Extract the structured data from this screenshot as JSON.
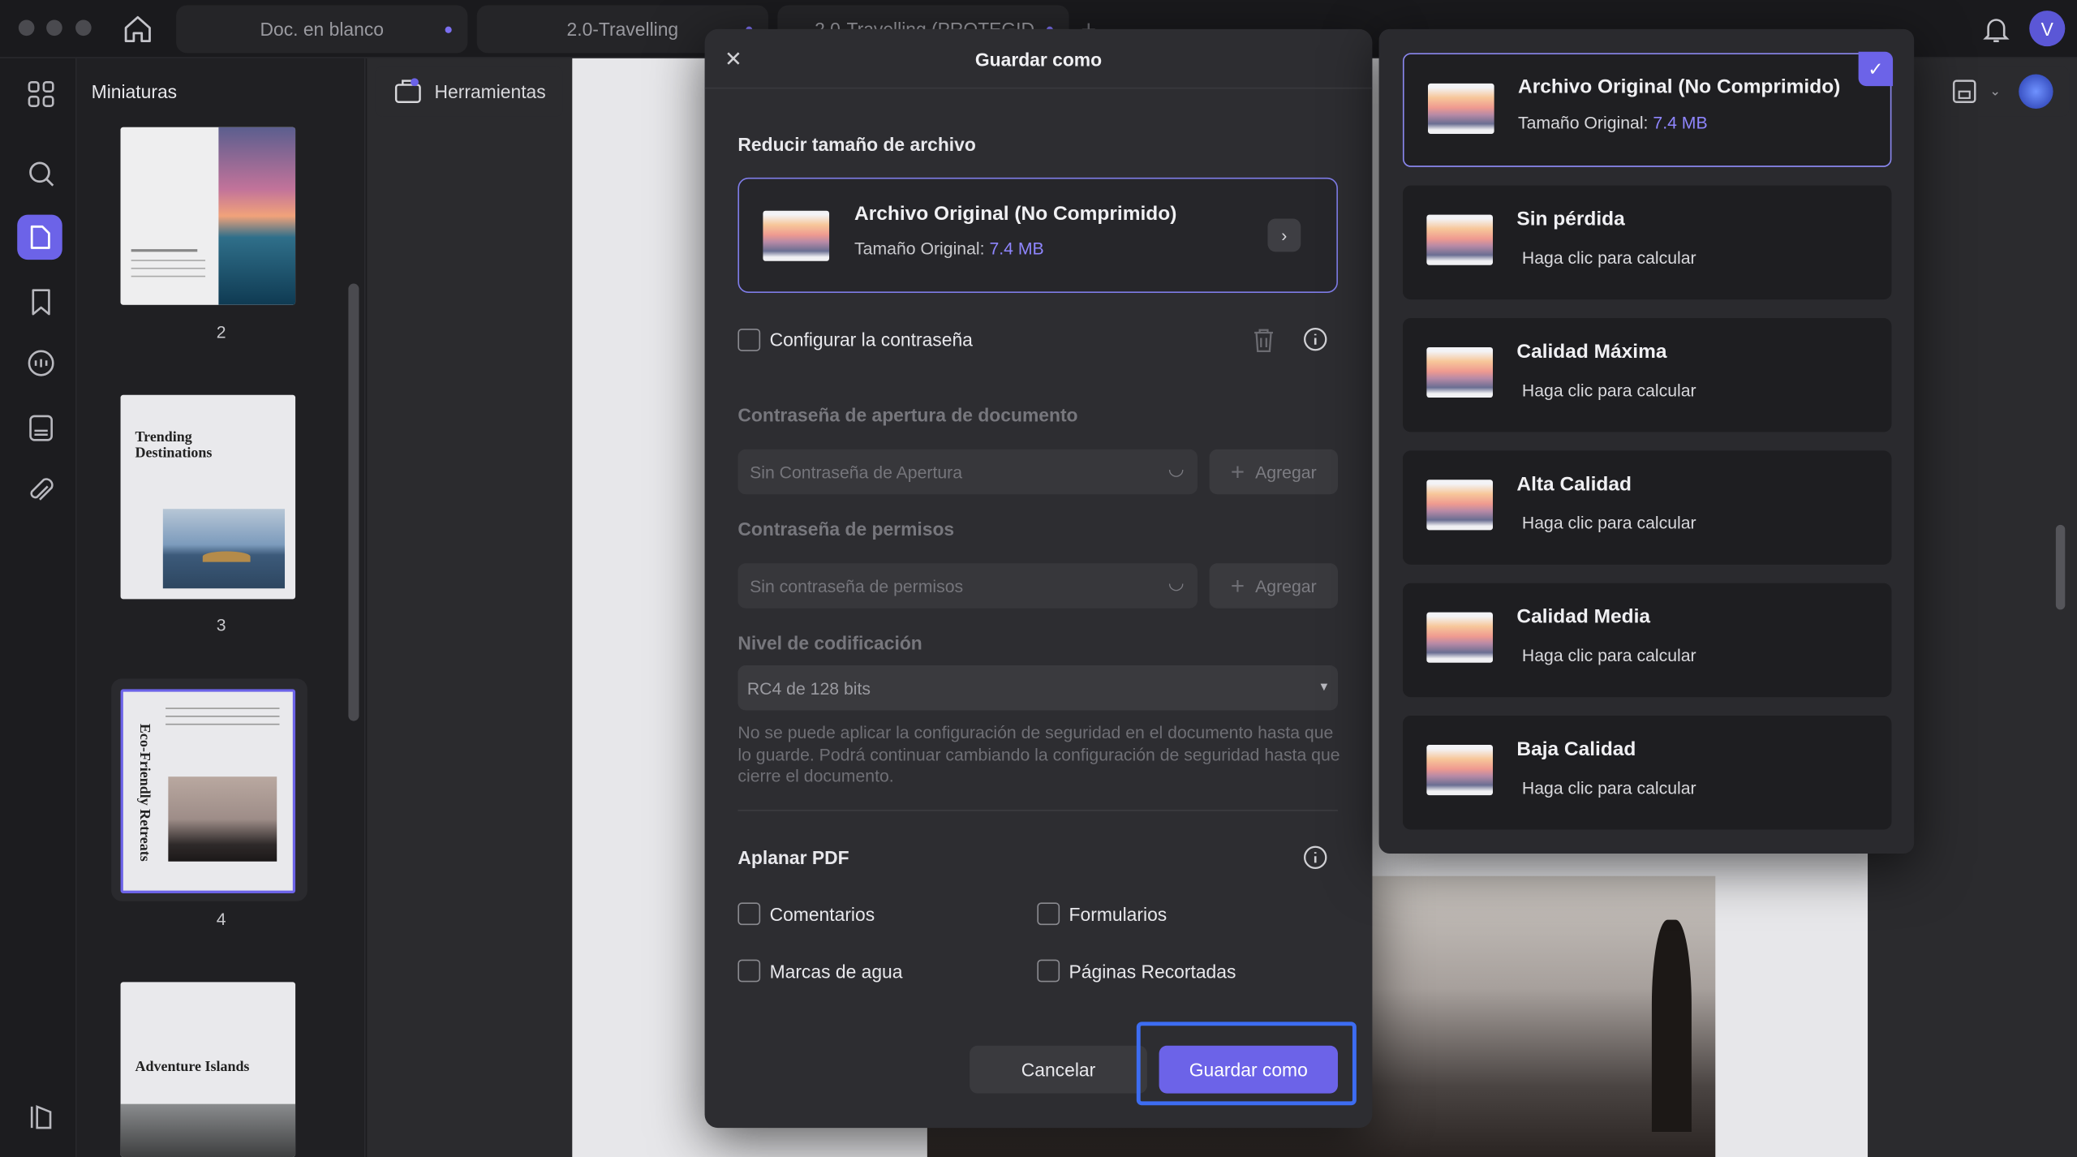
{
  "tabs": [
    {
      "label": "Doc. en blanco"
    },
    {
      "label": "2.0-Travelling"
    },
    {
      "label": "2.0-Travelling (PROTEGID"
    }
  ],
  "avatar_letter": "V",
  "sidebar": {
    "title": "Miniaturas",
    "tools_label": "Herramientas"
  },
  "thumbnails": [
    {
      "page": "2"
    },
    {
      "page": "3",
      "title": "Trending Destinations"
    },
    {
      "page": "4",
      "title": "Eco-Friendly Retreats"
    },
    {
      "title": "Adventure Islands"
    }
  ],
  "dialog": {
    "title": "Guardar como",
    "reduce_section": "Reducir tamaño de archivo",
    "selected_option": {
      "title": "Archivo Original (No Comprimido)",
      "size_label": "Tamaño Original:",
      "size_value": "7.4 MB"
    },
    "password_checkbox": "Configurar la contraseña",
    "open_password_label": "Contraseña de apertura de documento",
    "open_password_placeholder": "Sin Contraseña de Apertura",
    "add_label": "Agregar",
    "perm_password_label": "Contraseña de permisos",
    "perm_password_placeholder": "Sin contraseña de permisos",
    "encoding_label": "Nivel de codificación",
    "encoding_value": "RC4 de 128 bits",
    "security_note": "No se puede aplicar la configuración de seguridad en el documento hasta que lo guarde. Podrá continuar cambiando la configuración de seguridad hasta que cierre el documento.",
    "flatten_label": "Aplanar PDF",
    "flatten_options": {
      "comments": "Comentarios",
      "forms": "Formularios",
      "watermarks": "Marcas de agua",
      "cropped": "Páginas Recortadas"
    },
    "cancel": "Cancelar",
    "save": "Guardar como"
  },
  "compression": [
    {
      "title": "Archivo Original (No Comprimido)",
      "label": "Tamaño Original:",
      "value": "7.4 MB",
      "selected": true
    },
    {
      "title": "Sin pérdida",
      "label": "Haga clic para calcular"
    },
    {
      "title": "Calidad Máxima",
      "label": "Haga clic para calcular"
    },
    {
      "title": "Alta Calidad",
      "label": "Haga clic para calcular"
    },
    {
      "title": "Calidad Media",
      "label": "Haga clic para calcular"
    },
    {
      "title": "Baja Calidad",
      "label": "Haga clic para calcular"
    }
  ],
  "colors": {
    "accent": "#6c63e8",
    "accent_text": "#8f86ff",
    "focus_ring": "#3d6df2",
    "panel": "#2d2d31"
  }
}
